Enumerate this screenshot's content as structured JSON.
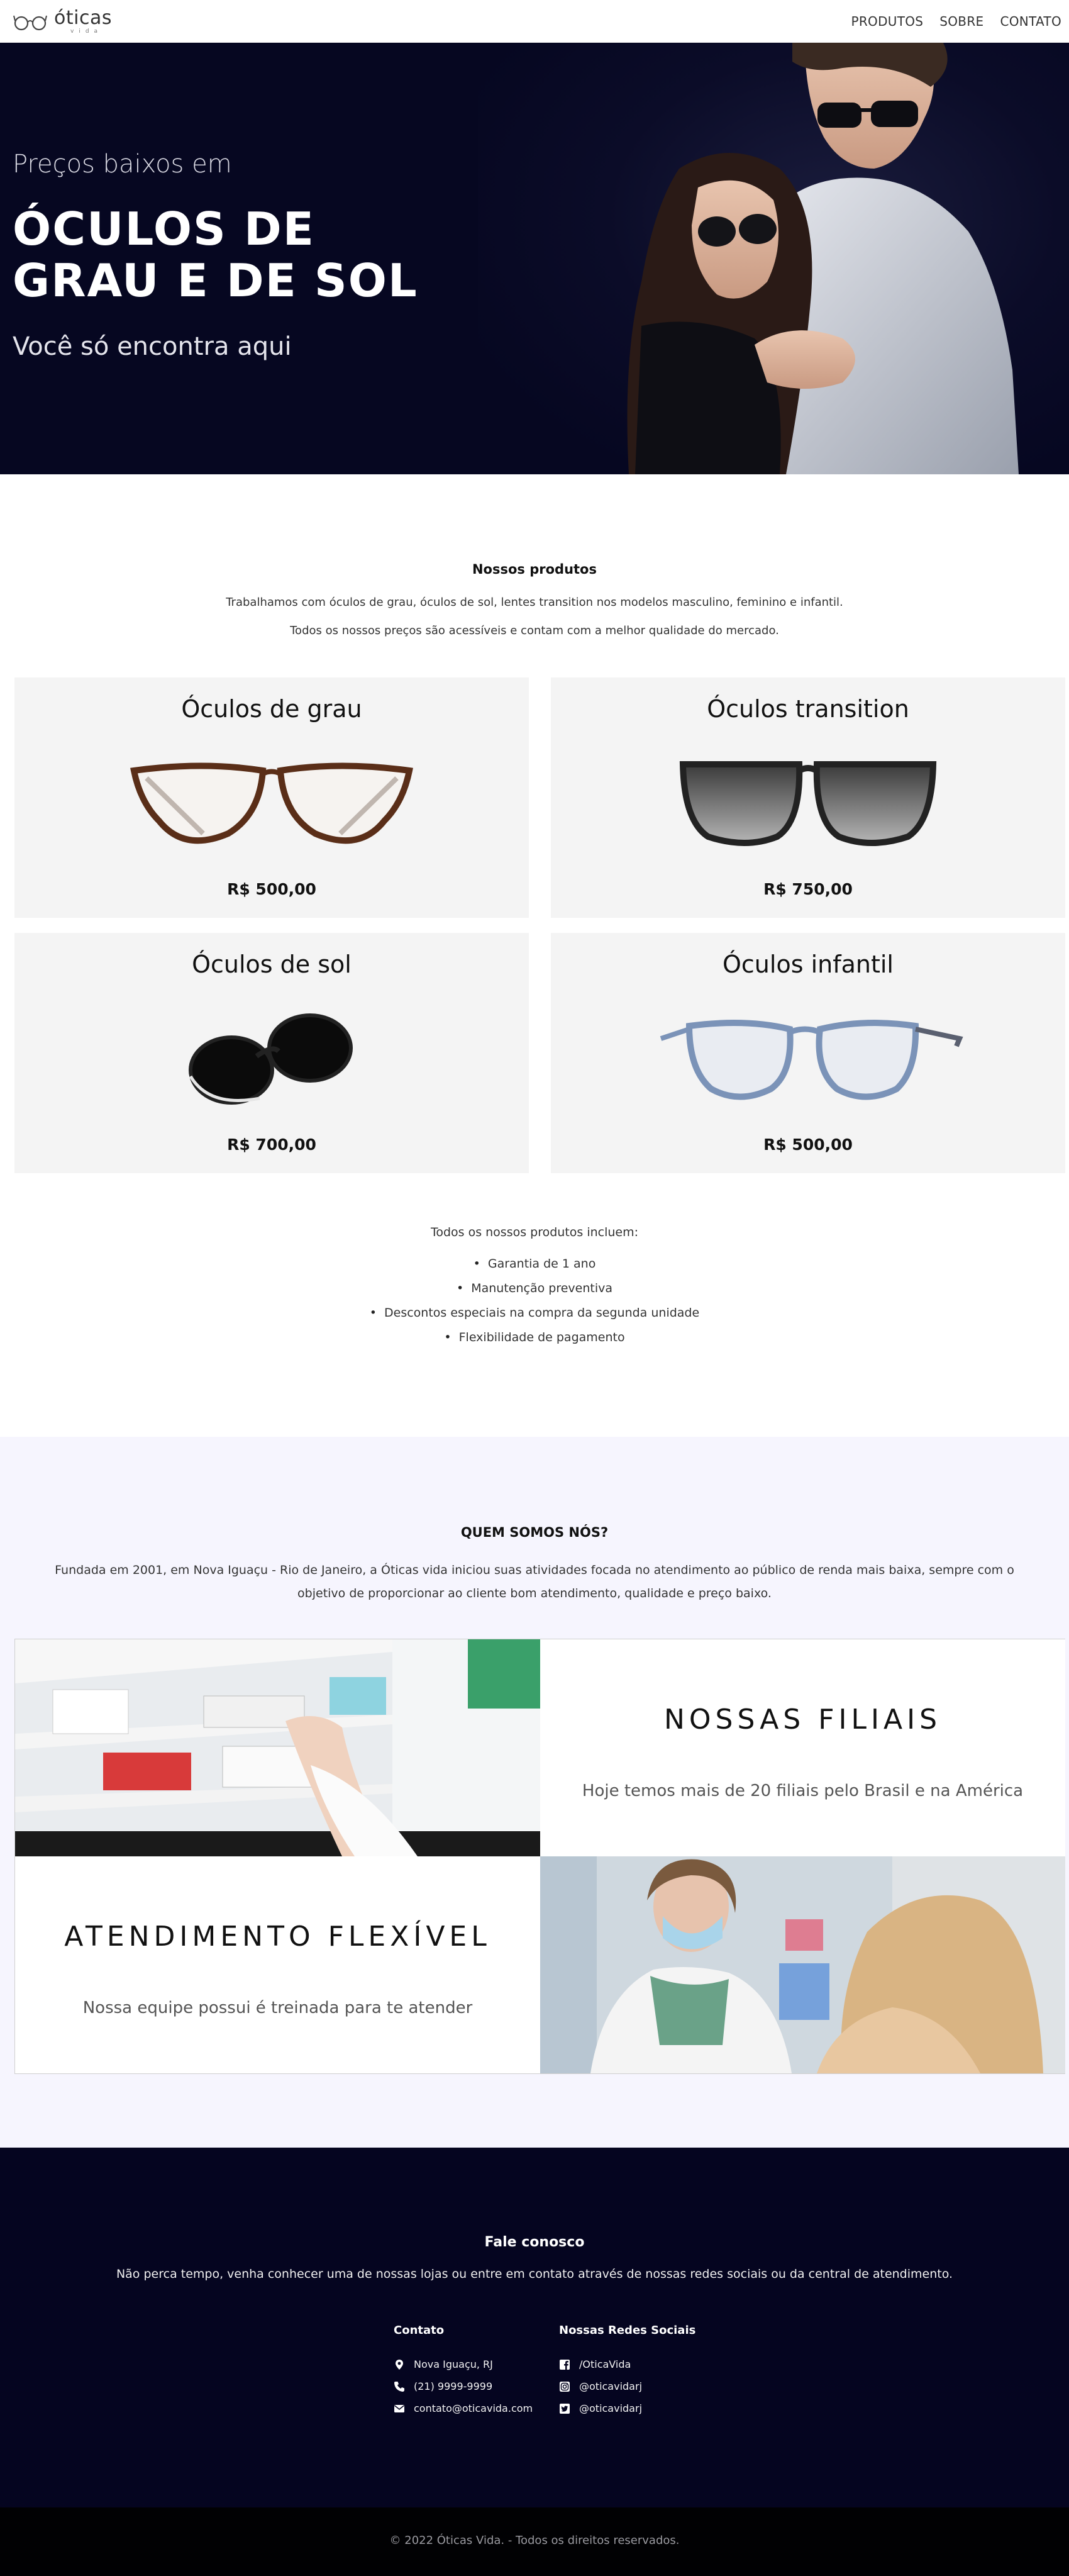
{
  "header": {
    "logo_main": "óticas",
    "logo_sub": "vida",
    "nav": [
      "PRODUTOS",
      "SOBRE",
      "CONTATO"
    ]
  },
  "hero": {
    "pre_title": "Preços baixos em",
    "title": "ÓCULOS DE GRAU E DE SOL",
    "post_title": "Você só encontra aqui"
  },
  "products": {
    "title": "Nossos produtos",
    "description_1": "Trabalhamos com óculos de grau, óculos de sol, lentes transition nos modelos masculino, feminino e infantil.",
    "description_2": "Todos os nossos preços são acessíveis e contam com a melhor qualidade do mercado.",
    "items": [
      {
        "name": "Óculos de grau",
        "price": "R$ 500,00"
      },
      {
        "name": "Óculos transition",
        "price": "R$ 750,00"
      },
      {
        "name": "Óculos de sol",
        "price": "R$ 700,00"
      },
      {
        "name": "Óculos infantil",
        "price": "R$ 500,00"
      }
    ],
    "includes_title": "Todos os nossos produtos incluem:",
    "includes": [
      "Garantia de 1 ano",
      "Manutenção preventiva",
      "Descontos especiais na compra da segunda unidade",
      "Flexibilidade de pagamento"
    ]
  },
  "about": {
    "title": "QUEM SOMOS NÓS?",
    "text": "Fundada em 2001, em Nova Iguaçu - Rio de Janeiro, a Óticas vida iniciou suas atividades focada no atendimento ao público de renda mais baixa, sempre com o objetivo de proporcionar ao cliente bom atendimento, qualidade e preço baixo.",
    "branches_heading": "NOSSAS FILIAIS",
    "branches_text": "Hoje temos mais de 20 filiais pelo Brasil e na América",
    "service_heading": "ATENDIMENTO FLEXÍVEL",
    "service_text": "Nossa equipe possui é treinada para te atender"
  },
  "contact": {
    "title": "Fale conosco",
    "text": "Não perca tempo, venha conhecer uma de nossas lojas ou entre em contato através de nossas redes sociais ou da central de atendimento.",
    "contact_title": "Contato",
    "address": "Nova Iguaçu, RJ",
    "phone": "(21) 9999-9999",
    "email": "contato@oticavida.com",
    "social_title": "Nossas Redes Sociais",
    "facebook": "/OticaVida",
    "instagram": "@oticavidarj",
    "twitter": "@oticavidarj"
  },
  "footer": {
    "text": "© 2022 Óticas Vida. - Todos os direitos reservados."
  }
}
